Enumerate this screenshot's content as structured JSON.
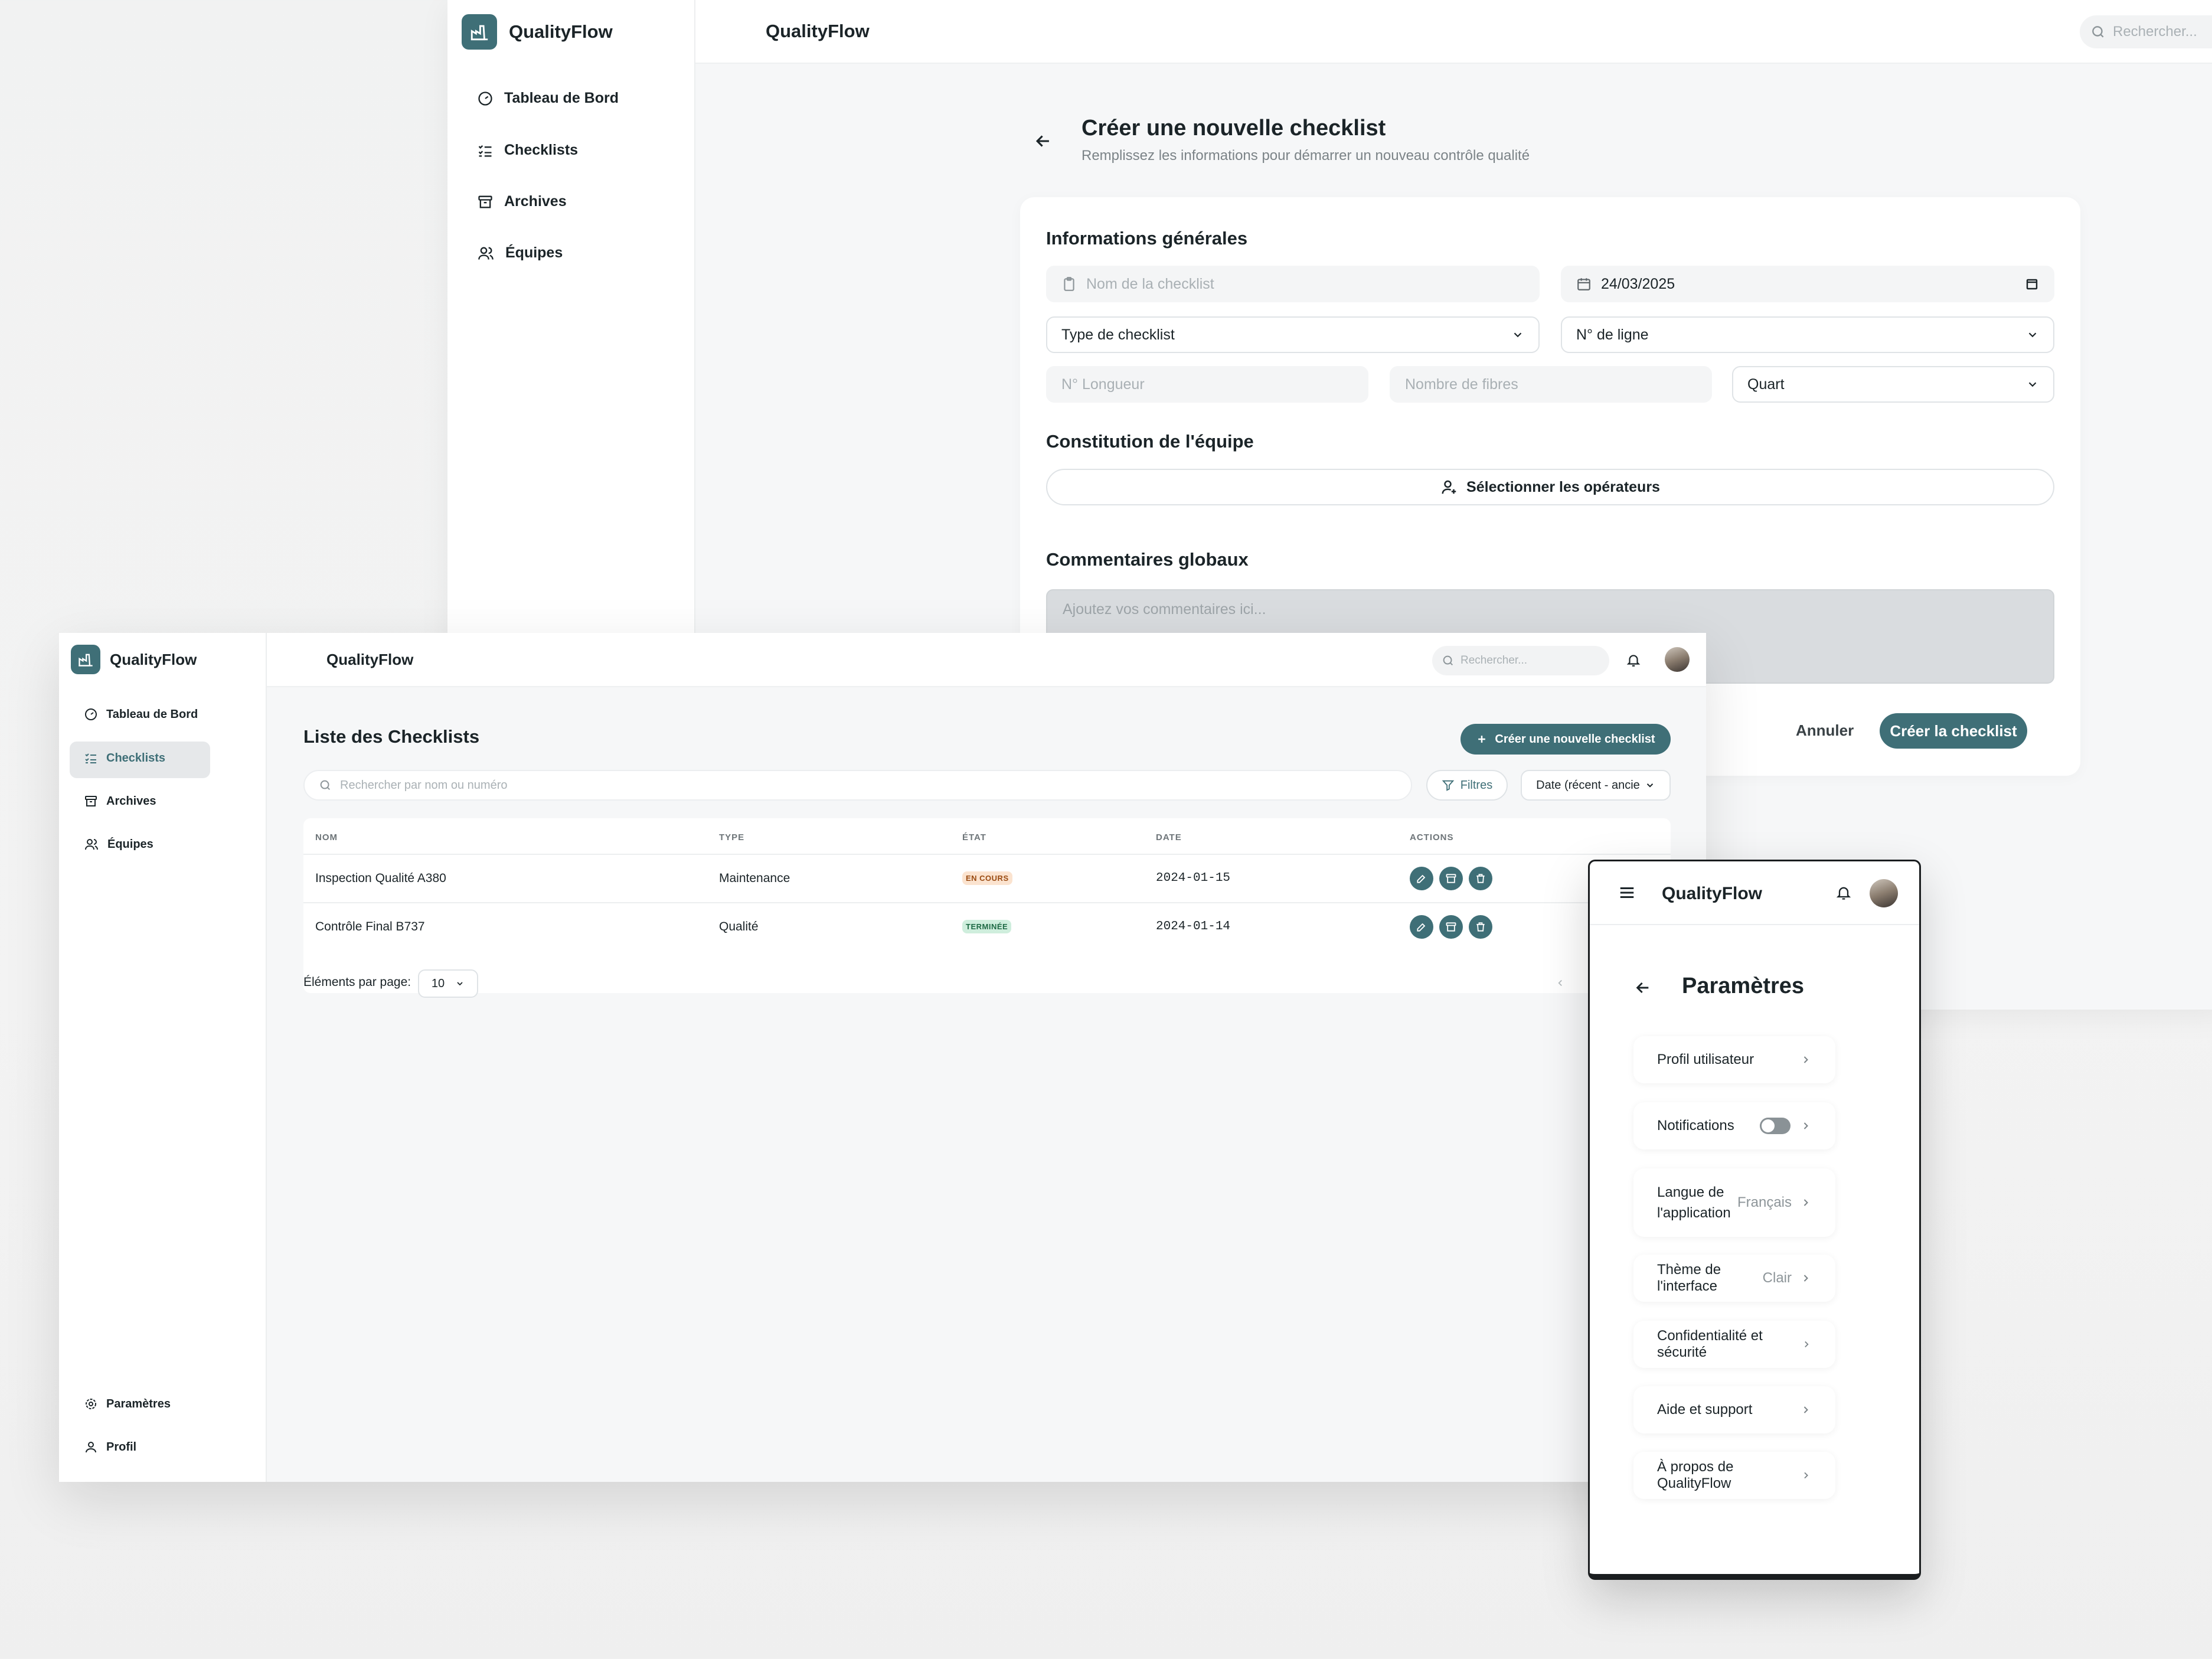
{
  "brand": "QualityFlow",
  "win1": {
    "header_title": "QualityFlow",
    "search_placeholder": "Rechercher...",
    "nav": [
      "Tableau de Bord",
      "Checklists",
      "Archives",
      "Équipes"
    ],
    "page_title": "Créer une nouvelle checklist",
    "page_subtitle": "Remplissez les informations pour démarrer un nouveau contrôle qualité",
    "section_general": "Informations générales",
    "name_placeholder": "Nom de la checklist",
    "date_value": "24/03/2025",
    "type_select": "Type de checklist",
    "line_select": "N° de ligne",
    "length_placeholder": "N° Longueur",
    "fibers_placeholder": "Nombre de fibres",
    "shift_select": "Quart",
    "section_team": "Constitution de l'équipe",
    "select_operators": "Sélectionner les opérateurs",
    "section_comments": "Commentaires globaux",
    "comments_placeholder": "Ajoutez vos commentaires ici...",
    "cancel": "Annuler",
    "create": "Créer la checklist"
  },
  "win2": {
    "header_title": "QualityFlow",
    "search_placeholder": "Rechercher...",
    "nav": [
      "Tableau de Bord",
      "Checklists",
      "Archives",
      "Équipes"
    ],
    "nav_bottom": [
      "Paramètres",
      "Profil"
    ],
    "page_title": "Liste des Checklists",
    "new_button": "Créer une nouvelle checklist",
    "list_search_placeholder": "Rechercher par nom ou numéro",
    "filters": "Filtres",
    "sort": "Date (récent - ancie",
    "columns": [
      "NOM",
      "TYPE",
      "ÉTAT",
      "DATE",
      "ACTIONS"
    ],
    "rows": [
      {
        "name": "Inspection Qualité A380",
        "type": "Maintenance",
        "state": "EN COURS",
        "date": "2024-01-15"
      },
      {
        "name": "Contrôle Final B737",
        "type": "Qualité",
        "state": "TERMINÉE",
        "date": "2024-01-14"
      }
    ],
    "per_page_label": "Éléments par page:",
    "per_page_value": "10"
  },
  "mobile": {
    "title": "QualityFlow",
    "page_title": "Paramètres",
    "items": [
      {
        "label": "Profil utilisateur",
        "value": ""
      },
      {
        "label": "Notifications",
        "value": ""
      },
      {
        "label": "Langue de l'application",
        "value": "Français"
      },
      {
        "label": "Thème de l'interface",
        "value": "Clair"
      },
      {
        "label": "Confidentialité et sécurité",
        "value": ""
      },
      {
        "label": "Aide et support",
        "value": ""
      },
      {
        "label": "À propos de QualityFlow",
        "value": ""
      }
    ],
    "notifications_on": false
  },
  "colors": {
    "accent": "#3f6f77",
    "badge_progress_bg": "#fbe3cf",
    "badge_progress_fg": "#9a4b12",
    "badge_done_bg": "#cfeedd",
    "badge_done_fg": "#1f6a45"
  }
}
